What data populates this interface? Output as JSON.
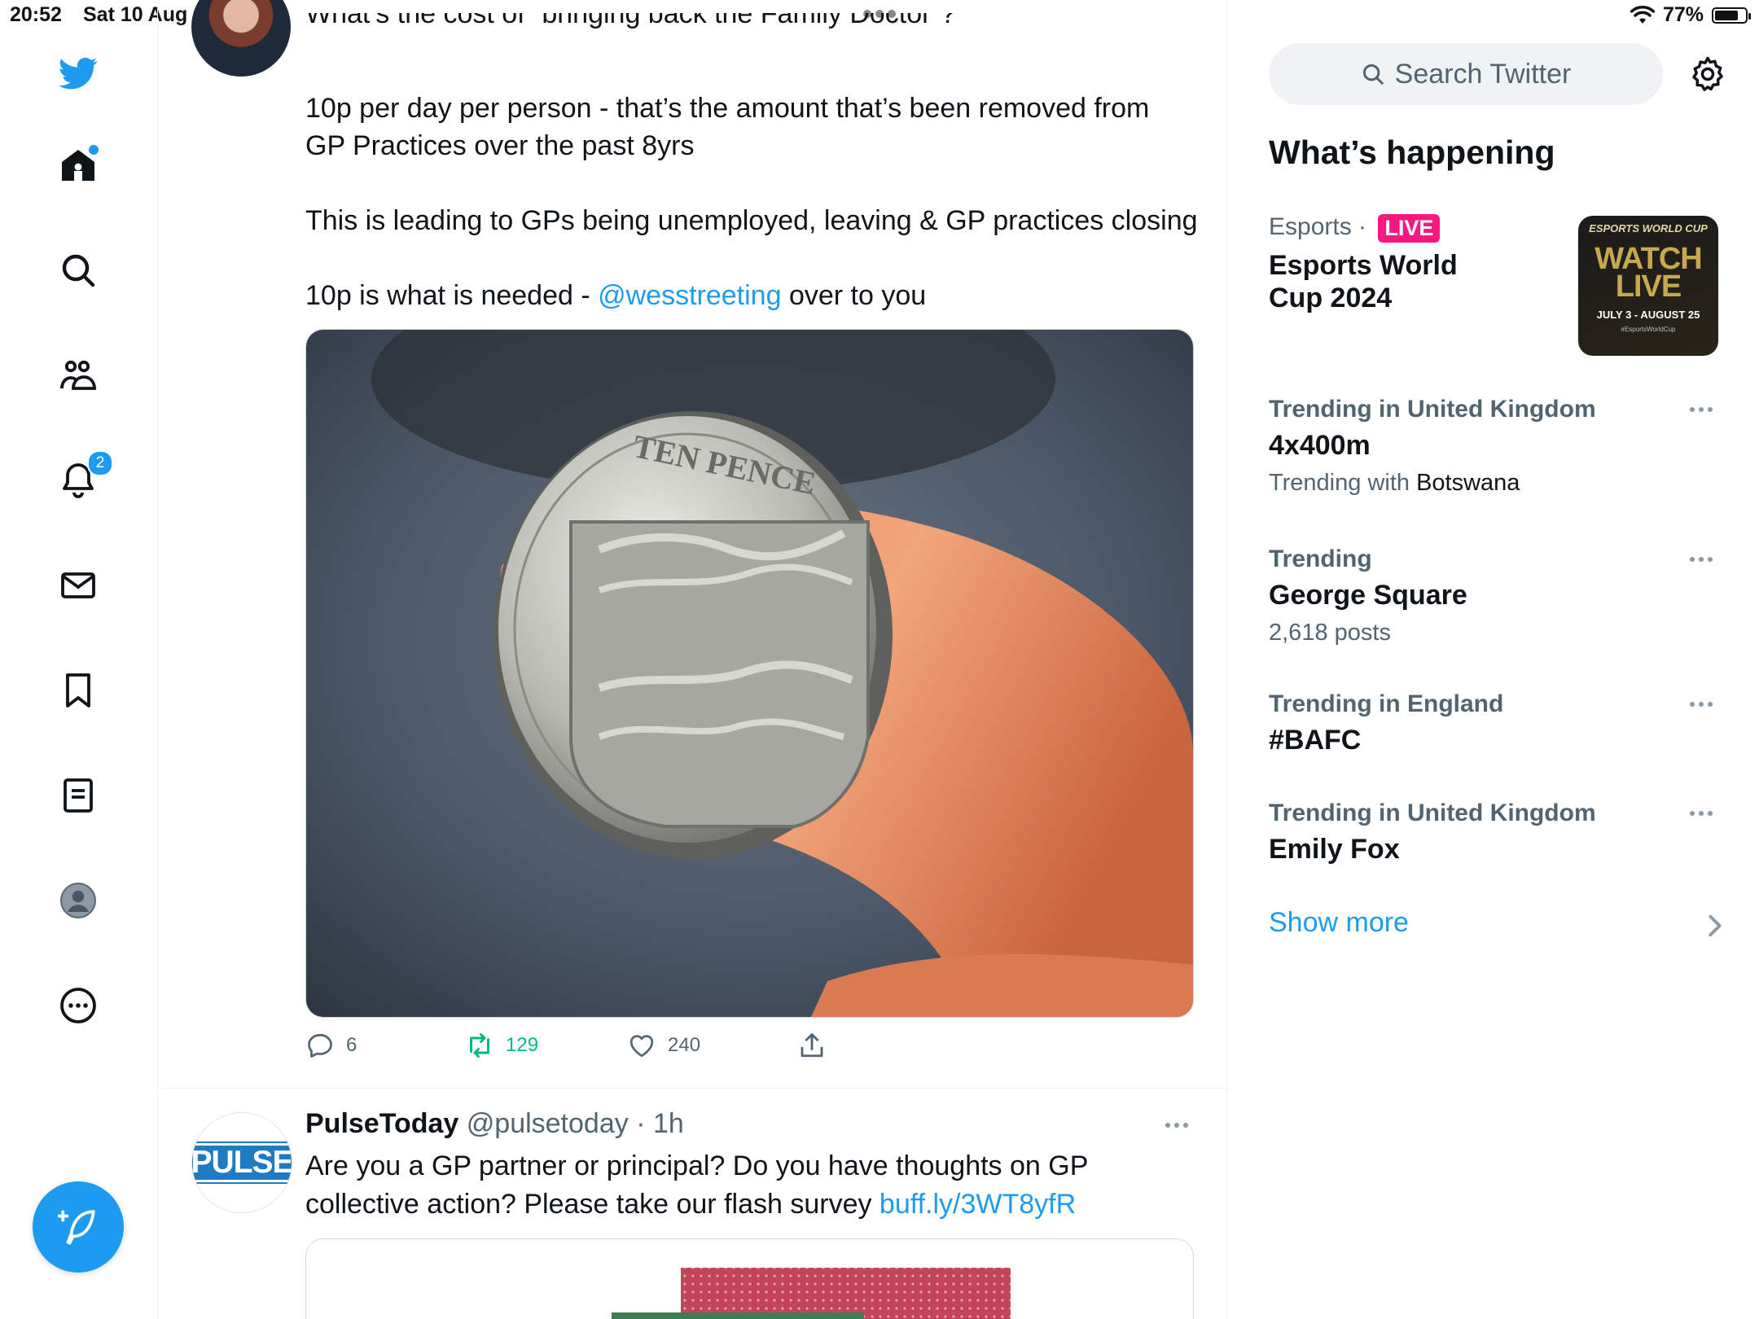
{
  "status_bar": {
    "time": "20:52",
    "date": "Sat 10 Aug",
    "battery": "77%",
    "battery_level": 0.77
  },
  "nav": {
    "items": [
      {
        "name": "twitter-logo",
        "label": "Twitter"
      },
      {
        "name": "home",
        "label": "Home"
      },
      {
        "name": "explore",
        "label": "Explore"
      },
      {
        "name": "communities",
        "label": "Communities"
      },
      {
        "name": "notifications",
        "label": "Notifications",
        "badge": "2"
      },
      {
        "name": "messages",
        "label": "Messages"
      },
      {
        "name": "bookmarks",
        "label": "Bookmarks"
      },
      {
        "name": "lists",
        "label": "Lists"
      },
      {
        "name": "profile",
        "label": "Profile"
      },
      {
        "name": "more",
        "label": "More"
      }
    ],
    "notification_badge": "2",
    "compose_icon": "compose-icon"
  },
  "tweet1": {
    "line0": "What’s the cost of “bringing back the Family Doctor”?",
    "line1": "10p per day per person - that’s the amount that’s been removed from",
    "line2": "GP Practices over the past 8yrs",
    "line3": "This is leading to GPs being unemployed, leaving & GP practices closing",
    "line4_prefix": "10p is what is needed - ",
    "line4_mention": "@wesstreeting",
    "line4_suffix": " over to you",
    "media_caption": "TEN PENCE",
    "replies": "6",
    "retweets": "129",
    "likes": "240"
  },
  "tweet2": {
    "name": "PulseToday",
    "handle": "@pulsetoday",
    "time": "1h",
    "avatar_text": "PULSE",
    "line1": "Are you a GP partner or principal? Do you have thoughts on GP",
    "line2_prefix": "collective action? Please take our flash survey ",
    "line2_link": "buff.ly/3WT8yfR"
  },
  "sidebar": {
    "search_placeholder": "Search Twitter",
    "title": "What’s happening",
    "featured": {
      "category": "Esports",
      "live": "LIVE",
      "name_line1": "Esports World",
      "name_line2": "Cup 2024",
      "thumb_brand": "ESPORTS WORLD CUP",
      "thumb_watch": "WATCH LIVE",
      "thumb_dates": "JULY 3 - AUGUST 25",
      "thumb_hash": "#EsportsWorldCup"
    },
    "trends": [
      {
        "category": "Trending in United Kingdom",
        "name": "4x400m",
        "sub_prefix": "Trending with ",
        "sub_highlight": "Botswana"
      },
      {
        "category": "Trending",
        "name": "George Square",
        "sub": "2,618 posts"
      },
      {
        "category": "Trending in England",
        "name": "#BAFC"
      },
      {
        "category": "Trending in United Kingdom",
        "name": "Emily Fox"
      }
    ],
    "show_more": "Show more"
  },
  "colors": {
    "accent": "#1d9bf0",
    "retweet_green": "#00ba7c",
    "live_pink": "#f91880",
    "muted_text": "#536471"
  }
}
